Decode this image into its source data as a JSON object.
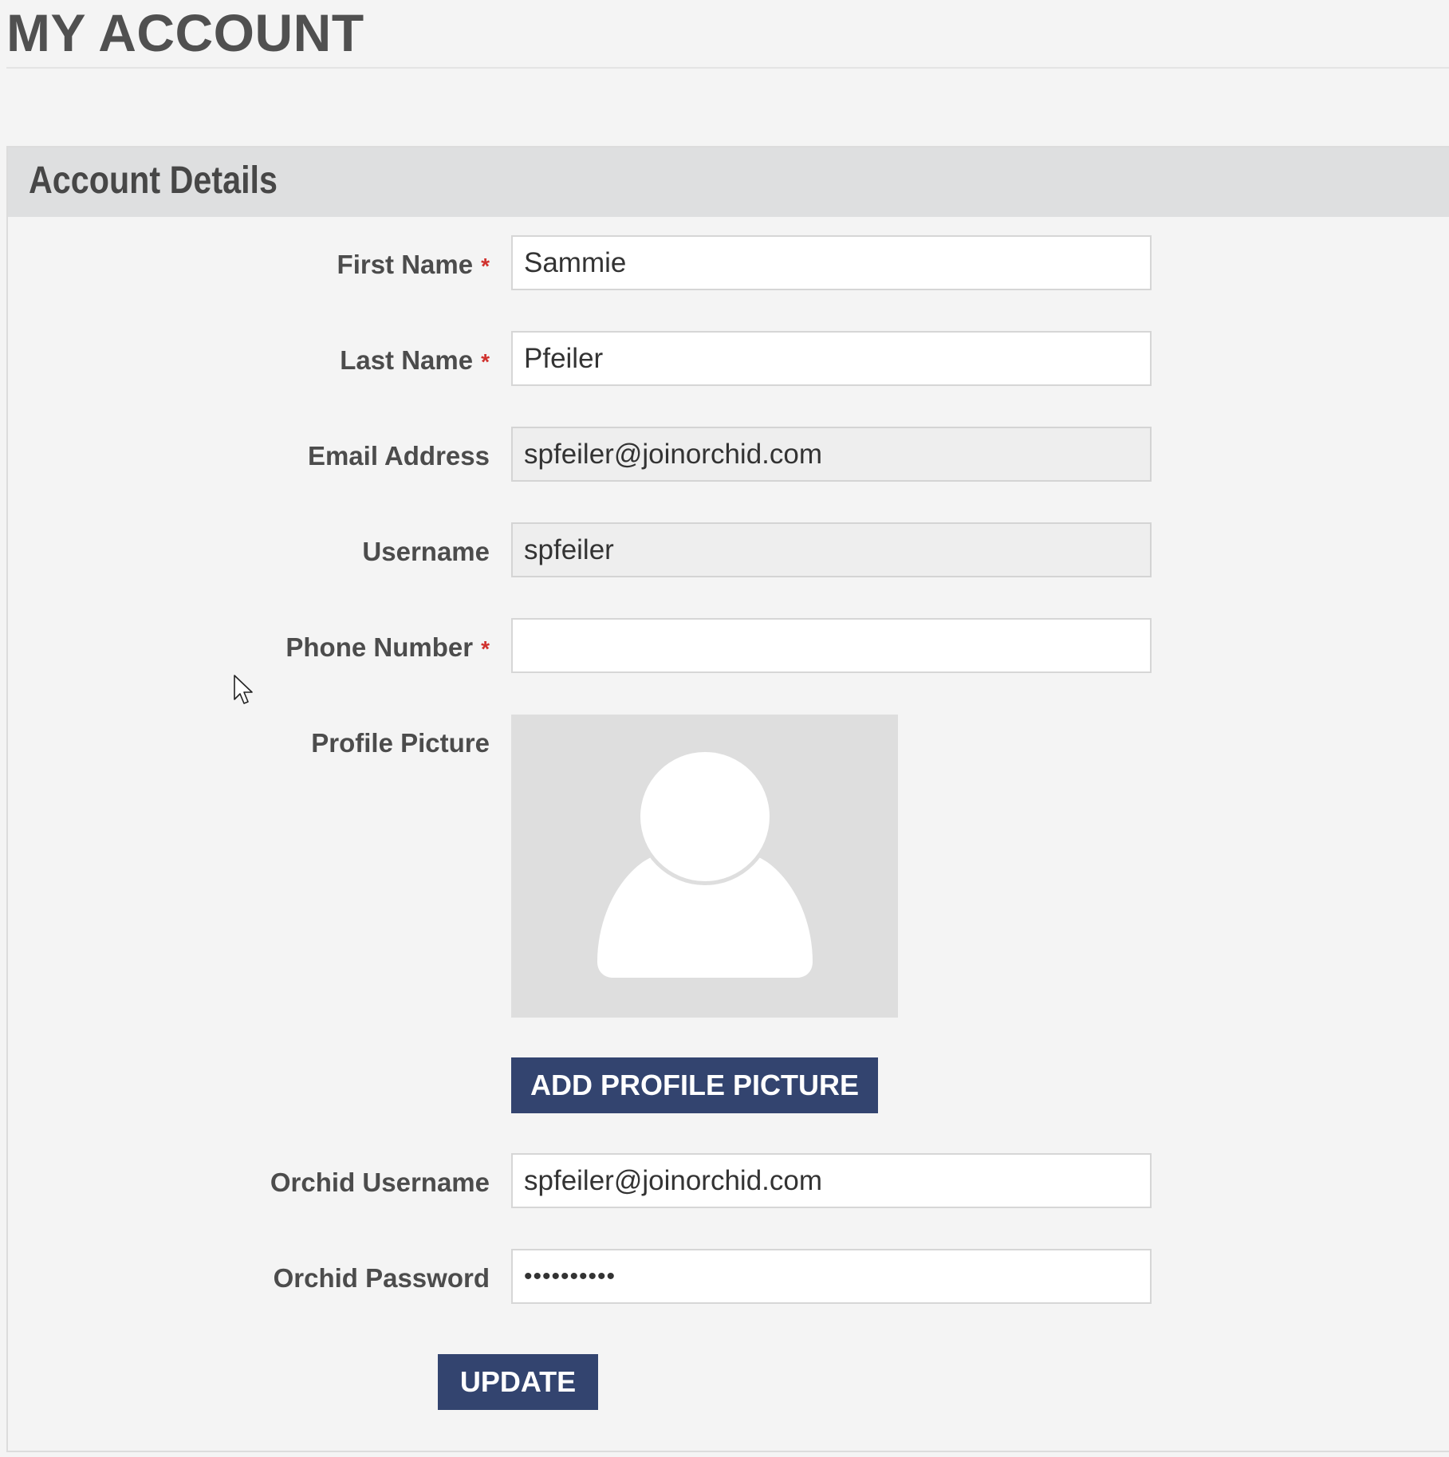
{
  "header": {
    "page_title": "MY ACCOUNT"
  },
  "panel": {
    "title": "Account Details"
  },
  "form": {
    "required_marker": "*",
    "first_name": {
      "label": "First Name",
      "value": "Sammie",
      "required": true
    },
    "last_name": {
      "label": "Last Name",
      "value": "Pfeiler",
      "required": true
    },
    "email": {
      "label": "Email Address",
      "value": "spfeiler@joinorchid.com",
      "readonly": true
    },
    "username": {
      "label": "Username",
      "value": "spfeiler",
      "readonly": true
    },
    "phone": {
      "label": "Phone Number",
      "value": "",
      "required": true
    },
    "profile_picture": {
      "label": "Profile Picture",
      "icon": "user-placeholder-icon",
      "button_label": "ADD PROFILE PICTURE"
    },
    "orchid_username": {
      "label": "Orchid Username",
      "value": "spfeiler@joinorchid.com"
    },
    "orchid_password": {
      "label": "Orchid Password",
      "value": "••••••••••"
    },
    "update_label": "UPDATE"
  },
  "colors": {
    "button_bg": "#33446f",
    "required": "#d0312d",
    "page_bg": "#f4f4f4",
    "panel_header_bg": "#dedfe0"
  }
}
